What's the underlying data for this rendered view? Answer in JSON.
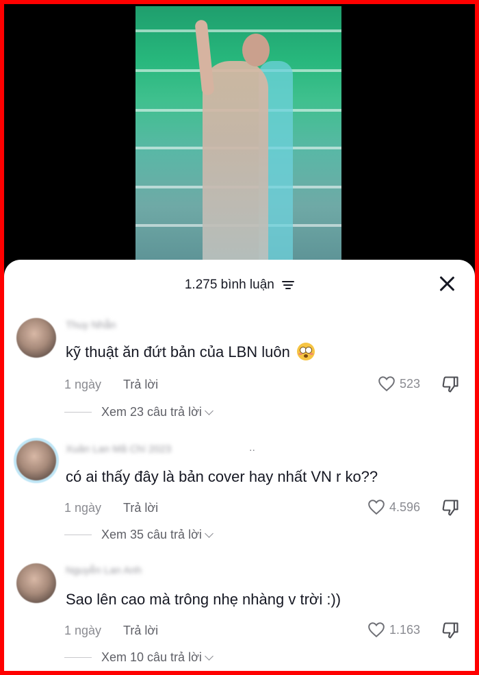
{
  "sheet": {
    "title": "1.275 bình luận",
    "filter_icon": "filter-lines-icon",
    "close_icon": "close-icon"
  },
  "comments": [
    {
      "username": "Thuy Nhẫn",
      "text": "kỹ thuật ăn đứt bản của LBN luôn",
      "emoji": "flushed-face",
      "time": "1 ngày",
      "reply_label": "Trả lời",
      "likes": "523",
      "view_replies": "Xem 23 câu trả lời"
    },
    {
      "username": "Xuân Lan Mã Chí 2023",
      "username_suffix": "..",
      "text": "có ai thấy đây là bản cover hay nhất VN r ko??",
      "time": "1 ngày",
      "reply_label": "Trả lời",
      "likes": "4.596",
      "view_replies": "Xem 35 câu trả lời"
    },
    {
      "username": "Nguyễn Lan Anh",
      "text": "Sao lên cao mà trông nhẹ nhàng v trời :))",
      "time": "1 ngày",
      "reply_label": "Trả lời",
      "likes": "1.163",
      "view_replies": "Xem 10 câu trả lời"
    }
  ]
}
